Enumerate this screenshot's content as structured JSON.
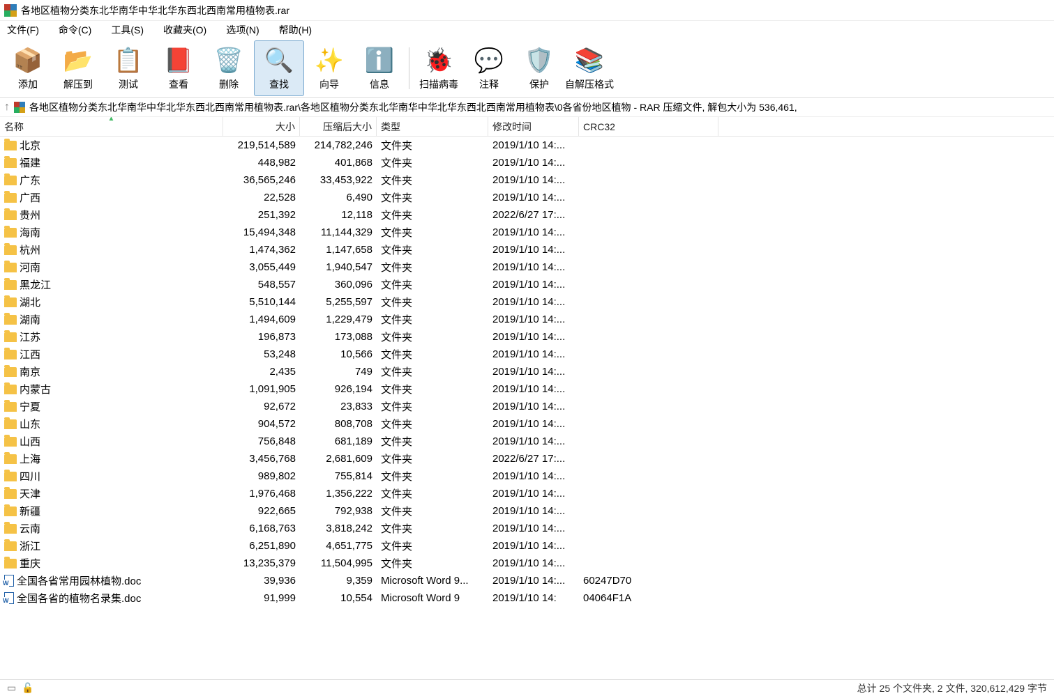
{
  "window": {
    "title": "各地区植物分类东北华南华中华北华东西北西南常用植物表.rar"
  },
  "menu": {
    "file": "文件(F)",
    "command": "命令(C)",
    "tools": "工具(S)",
    "favorites": "收藏夹(O)",
    "options": "选项(N)",
    "help": "帮助(H)"
  },
  "toolbar": {
    "add": "添加",
    "extract_to": "解压到",
    "test": "测试",
    "view": "查看",
    "delete": "删除",
    "find": "查找",
    "wizard": "向导",
    "info": "信息",
    "scan": "扫描病毒",
    "comment": "注释",
    "protect": "保护",
    "sfx": "自解压格式"
  },
  "pathbar": {
    "text": "各地区植物分类东北华南华中华北华东西北西南常用植物表.rar\\各地区植物分类东北华南华中华北华东西北西南常用植物表\\0各省份地区植物 - RAR 压缩文件, 解包大小为 536,461,"
  },
  "columns": {
    "name": "名称",
    "size": "大小",
    "packed": "压缩后大小",
    "type": "类型",
    "modified": "修改时间",
    "crc": "CRC32"
  },
  "type_labels": {
    "folder": "文件夹",
    "word": "Microsoft Word 9...",
    "word2": "Microsoft Word 9"
  },
  "rows": [
    {
      "icon": "folder",
      "name": "北京",
      "size": "219,514,589",
      "packed": "214,782,246",
      "type": "文件夹",
      "mtime": "2019/1/10 14:...",
      "crc": ""
    },
    {
      "icon": "folder",
      "name": "福建",
      "size": "448,982",
      "packed": "401,868",
      "type": "文件夹",
      "mtime": "2019/1/10 14:...",
      "crc": ""
    },
    {
      "icon": "folder",
      "name": "广东",
      "size": "36,565,246",
      "packed": "33,453,922",
      "type": "文件夹",
      "mtime": "2019/1/10 14:...",
      "crc": ""
    },
    {
      "icon": "folder",
      "name": "广西",
      "size": "22,528",
      "packed": "6,490",
      "type": "文件夹",
      "mtime": "2019/1/10 14:...",
      "crc": ""
    },
    {
      "icon": "folder",
      "name": "贵州",
      "size": "251,392",
      "packed": "12,118",
      "type": "文件夹",
      "mtime": "2022/6/27 17:...",
      "crc": ""
    },
    {
      "icon": "folder",
      "name": "海南",
      "size": "15,494,348",
      "packed": "11,144,329",
      "type": "文件夹",
      "mtime": "2019/1/10 14:...",
      "crc": ""
    },
    {
      "icon": "folder",
      "name": "杭州",
      "size": "1,474,362",
      "packed": "1,147,658",
      "type": "文件夹",
      "mtime": "2019/1/10 14:...",
      "crc": ""
    },
    {
      "icon": "folder",
      "name": "河南",
      "size": "3,055,449",
      "packed": "1,940,547",
      "type": "文件夹",
      "mtime": "2019/1/10 14:...",
      "crc": ""
    },
    {
      "icon": "folder",
      "name": "黑龙江",
      "size": "548,557",
      "packed": "360,096",
      "type": "文件夹",
      "mtime": "2019/1/10 14:...",
      "crc": ""
    },
    {
      "icon": "folder",
      "name": "湖北",
      "size": "5,510,144",
      "packed": "5,255,597",
      "type": "文件夹",
      "mtime": "2019/1/10 14:...",
      "crc": ""
    },
    {
      "icon": "folder",
      "name": "湖南",
      "size": "1,494,609",
      "packed": "1,229,479",
      "type": "文件夹",
      "mtime": "2019/1/10 14:...",
      "crc": ""
    },
    {
      "icon": "folder",
      "name": "江苏",
      "size": "196,873",
      "packed": "173,088",
      "type": "文件夹",
      "mtime": "2019/1/10 14:...",
      "crc": ""
    },
    {
      "icon": "folder",
      "name": "江西",
      "size": "53,248",
      "packed": "10,566",
      "type": "文件夹",
      "mtime": "2019/1/10 14:...",
      "crc": ""
    },
    {
      "icon": "folder",
      "name": "南京",
      "size": "2,435",
      "packed": "749",
      "type": "文件夹",
      "mtime": "2019/1/10 14:...",
      "crc": ""
    },
    {
      "icon": "folder",
      "name": "内蒙古",
      "size": "1,091,905",
      "packed": "926,194",
      "type": "文件夹",
      "mtime": "2019/1/10 14:...",
      "crc": ""
    },
    {
      "icon": "folder",
      "name": "宁夏",
      "size": "92,672",
      "packed": "23,833",
      "type": "文件夹",
      "mtime": "2019/1/10 14:...",
      "crc": ""
    },
    {
      "icon": "folder",
      "name": "山东",
      "size": "904,572",
      "packed": "808,708",
      "type": "文件夹",
      "mtime": "2019/1/10 14:...",
      "crc": ""
    },
    {
      "icon": "folder",
      "name": "山西",
      "size": "756,848",
      "packed": "681,189",
      "type": "文件夹",
      "mtime": "2019/1/10 14:...",
      "crc": ""
    },
    {
      "icon": "folder",
      "name": "上海",
      "size": "3,456,768",
      "packed": "2,681,609",
      "type": "文件夹",
      "mtime": "2022/6/27 17:...",
      "crc": ""
    },
    {
      "icon": "folder",
      "name": "四川",
      "size": "989,802",
      "packed": "755,814",
      "type": "文件夹",
      "mtime": "2019/1/10 14:...",
      "crc": ""
    },
    {
      "icon": "folder",
      "name": "天津",
      "size": "1,976,468",
      "packed": "1,356,222",
      "type": "文件夹",
      "mtime": "2019/1/10 14:...",
      "crc": ""
    },
    {
      "icon": "folder",
      "name": "新疆",
      "size": "922,665",
      "packed": "792,938",
      "type": "文件夹",
      "mtime": "2019/1/10 14:...",
      "crc": ""
    },
    {
      "icon": "folder",
      "name": "云南",
      "size": "6,168,763",
      "packed": "3,818,242",
      "type": "文件夹",
      "mtime": "2019/1/10 14:...",
      "crc": ""
    },
    {
      "icon": "folder",
      "name": "浙江",
      "size": "6,251,890",
      "packed": "4,651,775",
      "type": "文件夹",
      "mtime": "2019/1/10 14:...",
      "crc": ""
    },
    {
      "icon": "folder",
      "name": "重庆",
      "size": "13,235,379",
      "packed": "11,504,995",
      "type": "文件夹",
      "mtime": "2019/1/10 14:...",
      "crc": ""
    },
    {
      "icon": "doc",
      "name": "全国各省常用园林植物.doc",
      "size": "39,936",
      "packed": "9,359",
      "type": "Microsoft Word 9...",
      "mtime": "2019/1/10 14:...",
      "crc": "60247D70"
    },
    {
      "icon": "doc",
      "name": "全国各省的植物名录集.doc",
      "size": "91,999",
      "packed": "10,554",
      "type": "Microsoft Word 9",
      "mtime": "2019/1/10 14:",
      "crc": "04064F1A"
    }
  ],
  "status": {
    "summary": "总计 25 个文件夹, 2 文件, 320,612,429 字节"
  }
}
